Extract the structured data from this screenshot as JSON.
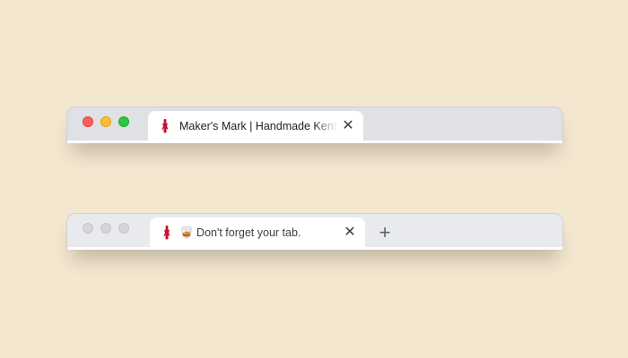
{
  "windows": [
    {
      "state": "active",
      "tab": {
        "favicon": "makers-mark-wax-bottle-icon",
        "title": "Maker's Mark | Handmade Kentucky Bourbon",
        "close_glyph": "✕"
      }
    },
    {
      "state": "inactive",
      "tab": {
        "favicon": "makers-mark-wax-bottle-icon",
        "title": "🥃 Don't forget your tab.",
        "close_glyph": "✕"
      },
      "new_tab_glyph": "+"
    }
  ],
  "colors": {
    "page_background": "#f4e7d0",
    "titlebar_active": "#dfe1e5",
    "titlebar_inactive": "#e8eaed",
    "traffic_close": "#fe5f57",
    "traffic_minimize": "#febc2e",
    "traffic_maximize": "#28c840",
    "favicon_wax": "#c8102e"
  }
}
